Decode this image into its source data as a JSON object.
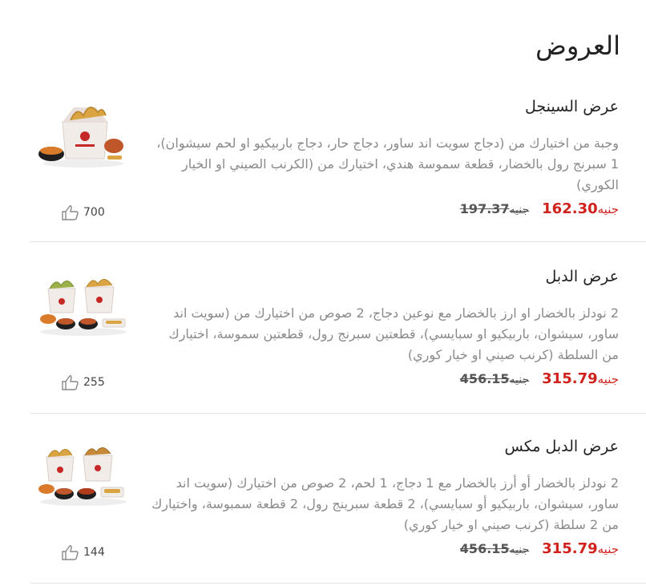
{
  "page": {
    "title": "العروض"
  },
  "currency": "جنيه",
  "offers": [
    {
      "name": "عرض السينجل",
      "description": "وجبة من اختيارك من (دجاج سويت اند ساور، دجاج حار، دجاج باربيكيو او لحم سيشوان)، 1 سبرنج رول بالخضار، قطعة سموسة هندي، اختيارك من (الكرنب الصيني او الخيار الكوري)",
      "new_price": "162.30",
      "old_price": "197.37",
      "likes": "700"
    },
    {
      "name": "عرض الدبل",
      "description": "2 نودلز بالخضار او ارز بالخضار مع نوعين دجاج، 2 صوص من اختيارك من (سويت اند ساور، سيشوان، باربيكيو او سبايسي)، قطعتين سبرنج رول، قطعتين سموسة، اختيارك من السلطة (كرنب صيني او خيار كوري)",
      "new_price": "315.79",
      "old_price": "456.15",
      "likes": "255"
    },
    {
      "name": "عرض الدبل مكس",
      "description": "2 نودلز بالخضار أو أرز بالخضار مع 1 دجاج، 1 لحم، 2 صوص من اختيارك (سويت اند ساور، سيشوان، باربيكيو أو سبايسي)، 2 قطعة سبرينج رول، 2 قطعة سمبوسة، واختيارك من 2 سلطة (كرنب صيني او خيار كوري)",
      "new_price": "315.79",
      "old_price": "456.15",
      "likes": "144"
    }
  ],
  "colors": {
    "price": "#d0211c",
    "text": "#222222",
    "muted": "#8a8a8a",
    "divider": "#e4e4e4"
  },
  "icons": {
    "likes": "thumbs-up-icon"
  }
}
